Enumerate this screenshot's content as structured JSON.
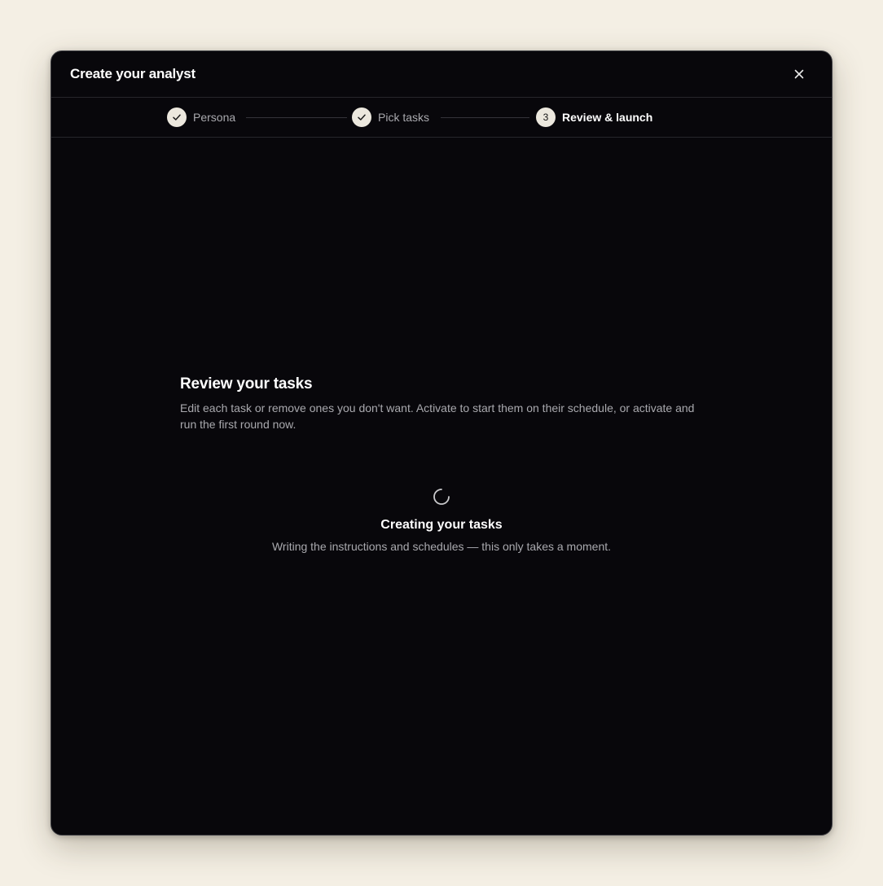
{
  "modal": {
    "title": "Create your analyst",
    "close_icon": "close-icon"
  },
  "stepper": {
    "steps": [
      {
        "label": "Persona",
        "state": "completed",
        "icon": "check-icon"
      },
      {
        "label": "Pick tasks",
        "state": "completed",
        "icon": "check-icon"
      },
      {
        "label": "Review & launch",
        "state": "current",
        "number": "3"
      }
    ]
  },
  "review": {
    "title": "Review your tasks",
    "description": "Edit each task or remove ones you don't want. Activate to start them on their schedule, or activate and run the first round now."
  },
  "loading": {
    "icon": "spinner-icon",
    "title": "Creating your tasks",
    "description": "Writing the instructions and schedules — this only takes a moment."
  },
  "colors": {
    "page_background": "#f4efe4",
    "modal_background": "#08070b",
    "step_circle": "#ece8de",
    "muted_text": "#a9a9ae"
  }
}
